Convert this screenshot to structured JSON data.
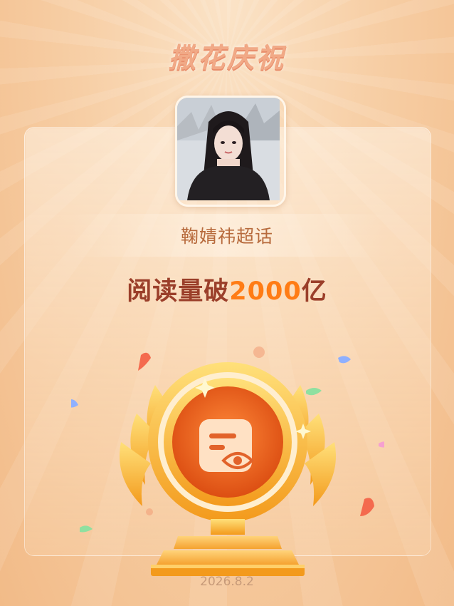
{
  "header": {
    "title": "撒花庆祝"
  },
  "card": {
    "topic_name": "鞠婧祎超话",
    "milestone_prefix": "阅读量破",
    "milestone_number": "2000",
    "milestone_suffix": "亿",
    "date": "2026.8.2"
  },
  "icons": {
    "badge": "document-eye-icon",
    "trophy": "trophy-icon"
  },
  "colors": {
    "accent_orange": "#ff7c15",
    "milestone_text": "#9b3f2a",
    "topic_text": "#b76a3c",
    "background": "#f7cfa6"
  }
}
